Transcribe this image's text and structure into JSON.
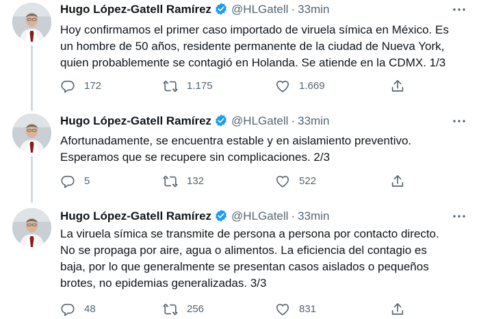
{
  "colors": {
    "verified": "#1d9bf0",
    "secondary_text": "#536471",
    "thread_line": "#cfd9de"
  },
  "icons": [
    "reply-icon",
    "retweet-icon",
    "like-icon",
    "share-icon",
    "more-icon",
    "verified-icon"
  ],
  "tweets": [
    {
      "name": "Hugo López-Gatell Ramírez",
      "handle": "@HLGatell",
      "separator": "·",
      "time": "33min",
      "lines": [
        "Hoy confirmamos el primer caso importado de viruela símica en México. Es",
        "un hombre de 50 años, residente permanente de la ciudad de Nueva York,",
        "quien probablemente se contagió en Holanda. Se atiende en la CDMX. 1/3"
      ],
      "replies": "172",
      "retweets": "1.175",
      "likes": "1.669"
    },
    {
      "name": "Hugo López-Gatell Ramírez",
      "handle": "@HLGatell",
      "separator": "·",
      "time": "33min",
      "lines": [
        "Afortunadamente, se encuentra estable y en aislamiento preventivo.",
        "Esperamos que se recupere sin complicaciones. 2/3"
      ],
      "replies": "5",
      "retweets": "132",
      "likes": "522"
    },
    {
      "name": "Hugo López-Gatell Ramírez",
      "handle": "@HLGatell",
      "separator": "·",
      "time": "33min",
      "lines": [
        "La viruela símica se transmite de persona a persona por contacto directo.",
        "No se propaga por aire, agua o alimentos. La eficiencia del contagio es",
        "baja, por lo que generalmente se presentan casos aislados o pequeños",
        "brotes, no epidemias generalizadas. 3/3"
      ],
      "replies": "48",
      "retweets": "256",
      "likes": "831"
    }
  ]
}
